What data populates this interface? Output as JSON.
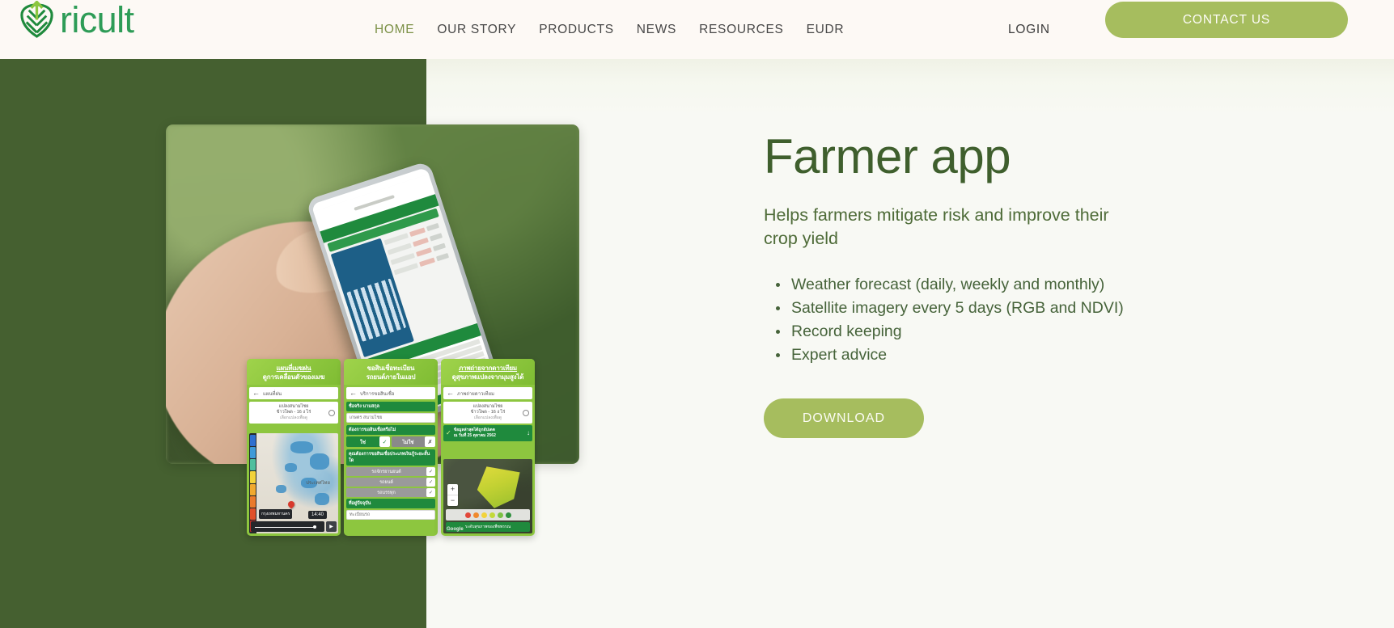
{
  "header": {
    "logo_text": "ricult",
    "logo_icon": "leaf-arrow-icon",
    "nav": [
      {
        "label": "HOME",
        "active": true
      },
      {
        "label": "OUR STORY",
        "active": false
      },
      {
        "label": "PRODUCTS",
        "active": false
      },
      {
        "label": "NEWS",
        "active": false
      },
      {
        "label": "RESOURCES",
        "active": false
      },
      {
        "label": "EUDR",
        "active": false
      }
    ],
    "login_label": "LOGIN",
    "contact_label": "CONTACT US"
  },
  "hero": {
    "title": "Farmer app",
    "subtitle": "Helps farmers mitigate risk and improve their crop yield",
    "features": [
      "Weather forecast (daily, weekly and monthly)",
      "Satellite imagery every 5 days (RGB and NDVI)",
      "Record keeping",
      "Expert advice"
    ],
    "download_label": "DOWNLOAD"
  },
  "app_panels": [
    {
      "heading_line1": "แผนที่เมฆฝน",
      "heading_line2": "ดูการเคลื่อนตัวของเมฆ",
      "app_bar_label": "แผนที่ฝน",
      "field_line1": "แปลงสนามไชย",
      "field_line2": "ข้าวโพด - 16 ง ไร่",
      "field_line3": "เลือกแปลงเพื่อดู",
      "map_country_label": "ประเทศไทย",
      "map_city_label": "กรุงเทพมหานคร",
      "time_label": "14:40"
    },
    {
      "heading_line1": "ขอสินเชื่อทะเบียน",
      "heading_line2": "รถยนต์ภายในแอป",
      "app_bar_label": "บริการขอสินเชื่อ",
      "name_label": "ชื่อจริง นามสกุล",
      "name_value": "เกษตร สนามไชย",
      "question_label": "ต้องการขอสินเชื่อหรือไม่",
      "yes_label": "ใช่",
      "no_label": "ไม่ใช่",
      "options_label": "คุณต้องการขอสินเชื่อประเภทเงินกู้ระยะสั้นใด",
      "options": [
        "รถจักรยานยนต์",
        "รถยนต์",
        "รถบรรทุก",
        "ทะเบียนรถ"
      ],
      "footer_label": "ที่อยู่ปัจจุบัน"
    },
    {
      "heading_line1": "ภาพถ่ายจากดาวเทียม",
      "heading_line2": "ดูสุขภาพแปลงจากมุมสูงได้",
      "app_bar_label": "ภาพถ่ายดาวเทียม",
      "field_line1": "แปลงสนามไชย",
      "field_line2": "ข้าวโพด - 16 ง ไร่",
      "field_line3": "เลือกแปลงเพื่อดู",
      "banner_line1": "ข้อมูลล่าสุดได้ถูกอัปเดต",
      "banner_line2": "ณ วันที่ 25 ตุลาคม 2562",
      "zoom_in": "+",
      "zoom_out": "−",
      "legend_label": "ระดับสุขภาพของพืชพรรณ",
      "watermark": "Google"
    }
  ],
  "colors": {
    "brand_green": "#2e9c57",
    "accent_olive": "#a6bd5e",
    "panel_dark_green": "#456030",
    "header_bg": "#fdf9f5",
    "hero_bg": "#f8f9f4",
    "heading_green": "#3f5f2d",
    "body_green": "#46633a",
    "app_green": "#1f8a3d",
    "panel_lime": "#8dc63f"
  }
}
